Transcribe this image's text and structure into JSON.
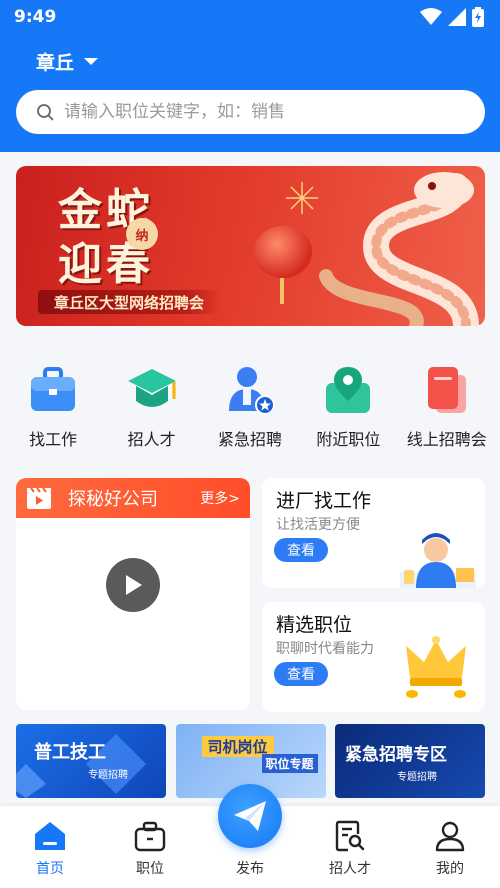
{
  "status_bar": {
    "time": "9:49"
  },
  "location": {
    "city": "章丘"
  },
  "search": {
    "placeholder": "请输入职位关键字，如：销售"
  },
  "banner": {
    "title_line1": "金蛇",
    "title_line2": "迎春",
    "seal": "纳",
    "subtitle": "章丘区大型网络招聘会"
  },
  "quick_links": [
    {
      "label": "找工作",
      "icon": "briefcase-icon"
    },
    {
      "label": "招人才",
      "icon": "graduation-cap-icon"
    },
    {
      "label": "紧急招聘",
      "icon": "urgent-person-icon"
    },
    {
      "label": "附近职位",
      "icon": "map-pin-icon"
    },
    {
      "label": "线上招聘会",
      "icon": "online-fair-icon"
    }
  ],
  "video_card": {
    "title": "探秘好公司",
    "more": "更多>"
  },
  "promo_cards": [
    {
      "title": "进厂找工作",
      "subtitle": "让找活更方便",
      "button": "查看"
    },
    {
      "title": "精选职位",
      "subtitle": "职聊时代看能力",
      "button": "查看"
    }
  ],
  "tiles": [
    {
      "title": "普工技工",
      "subtitle": "专题招聘"
    },
    {
      "title": "司机岗位",
      "subtitle": "职位专题"
    },
    {
      "title": "紧急招聘专区",
      "subtitle": "专题招聘"
    }
  ],
  "tabbar": [
    {
      "label": "首页",
      "active": true
    },
    {
      "label": "职位",
      "active": false
    },
    {
      "label": "发布",
      "active": false
    },
    {
      "label": "招人才",
      "active": false
    },
    {
      "label": "我的",
      "active": false
    }
  ],
  "colors": {
    "primary": "#1677f7",
    "accent_orange": "#ff5a2f",
    "banner_red": "#d42a20"
  }
}
